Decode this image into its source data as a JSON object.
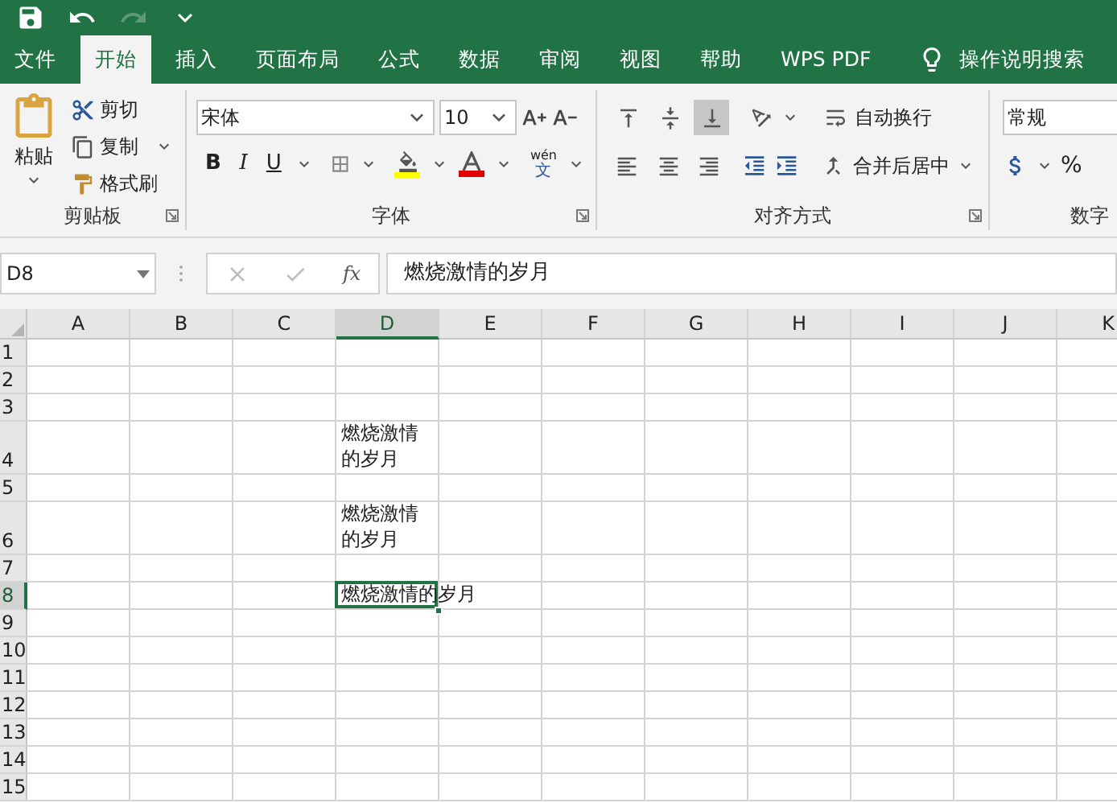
{
  "quick_access": [
    {
      "kind": "save",
      "disabled": false
    },
    {
      "kind": "undo",
      "disabled": false
    },
    {
      "kind": "redo",
      "disabled": true
    },
    {
      "kind": "customize",
      "disabled": false
    }
  ],
  "tabs": [
    {
      "label": "文件",
      "selected": false
    },
    {
      "label": "开始",
      "selected": true
    },
    {
      "label": "插入",
      "selected": false
    },
    {
      "label": "页面布局",
      "selected": false
    },
    {
      "label": "公式",
      "selected": false
    },
    {
      "label": "数据",
      "selected": false
    },
    {
      "label": "审阅",
      "selected": false
    },
    {
      "label": "视图",
      "selected": false
    },
    {
      "label": "帮助",
      "selected": false
    },
    {
      "label": "WPS PDF",
      "selected": false
    }
  ],
  "search": {
    "label": "操作说明搜索"
  },
  "clipboard": {
    "title": "剪贴板",
    "paste": "粘贴",
    "cut": "剪切",
    "copy": "复制",
    "format_painter": "格式刷"
  },
  "font": {
    "title": "字体",
    "font_name": "宋体",
    "font_size": "10",
    "bold": "B",
    "italic": "I",
    "underline": "U",
    "phonetic_top": "wén",
    "phonetic_bottom": "文"
  },
  "alignment": {
    "title": "对齐方式",
    "vertical": [
      {
        "kind": "top",
        "selected": false
      },
      {
        "kind": "middle",
        "selected": false
      },
      {
        "kind": "bottom",
        "selected": true
      }
    ],
    "horizontal": [
      {
        "kind": "left",
        "selected": false
      },
      {
        "kind": "center",
        "selected": false
      },
      {
        "kind": "right",
        "selected": false
      }
    ],
    "wrap_text": "自动换行",
    "merge_center": "合并后居中"
  },
  "number": {
    "title": "数字",
    "format": "常规",
    "percent": "%"
  },
  "formula_bar": {
    "name_box": "D8",
    "fx": "fx",
    "content": "燃烧激情的岁月"
  },
  "sheet": {
    "columns": [
      {
        "label": "A",
        "selected": false
      },
      {
        "label": "B",
        "selected": false
      },
      {
        "label": "C",
        "selected": false
      },
      {
        "label": "D",
        "selected": true
      },
      {
        "label": "E",
        "selected": false
      },
      {
        "label": "F",
        "selected": false
      },
      {
        "label": "G",
        "selected": false
      },
      {
        "label": "H",
        "selected": false
      },
      {
        "label": "I",
        "selected": false
      },
      {
        "label": "J",
        "selected": false
      },
      {
        "label": "K",
        "selected": false
      }
    ],
    "rows": [
      {
        "label": "1",
        "kind": "normal",
        "selected": false
      },
      {
        "label": "2",
        "kind": "normal",
        "selected": false
      },
      {
        "label": "3",
        "kind": "normal",
        "selected": false
      },
      {
        "label": "4",
        "kind": "tall",
        "selected": false,
        "cells": [
          null,
          null,
          null,
          {
            "text": "燃烧激情的岁月",
            "kind": "wrap",
            "selected": false
          }
        ]
      },
      {
        "label": "5",
        "kind": "normal",
        "selected": false
      },
      {
        "label": "6",
        "kind": "tall",
        "selected": false,
        "cells": [
          null,
          null,
          null,
          {
            "text": "燃烧激情的岁月",
            "kind": "wrap",
            "selected": false
          }
        ]
      },
      {
        "label": "7",
        "kind": "normal",
        "selected": false
      },
      {
        "label": "8",
        "kind": "normal",
        "selected": true,
        "cells": [
          null,
          null,
          null,
          {
            "text": "燃烧激情的岁月",
            "kind": "overflow",
            "selected": true
          }
        ]
      },
      {
        "label": "9",
        "kind": "normal",
        "selected": false
      },
      {
        "label": "10",
        "kind": "normal",
        "selected": false
      },
      {
        "label": "11",
        "kind": "normal",
        "selected": false
      },
      {
        "label": "12",
        "kind": "normal",
        "selected": false
      },
      {
        "label": "13",
        "kind": "normal",
        "selected": false
      },
      {
        "label": "14",
        "kind": "normal",
        "selected": false
      },
      {
        "label": "15",
        "kind": "normal",
        "selected": false
      }
    ]
  }
}
